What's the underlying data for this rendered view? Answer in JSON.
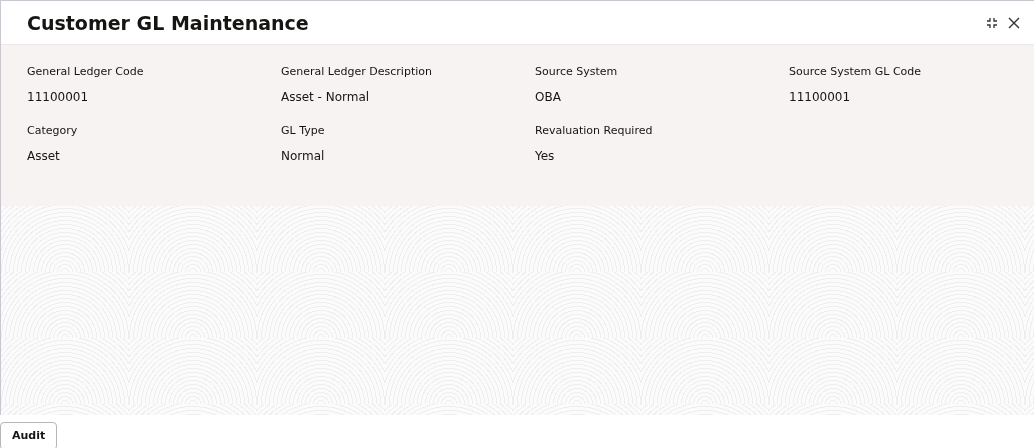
{
  "window": {
    "title": "Customer GL Maintenance"
  },
  "fields": [
    {
      "label": "General Ledger Code",
      "value": "11100001"
    },
    {
      "label": "General Ledger Description",
      "value": "Asset - Normal"
    },
    {
      "label": "Source System",
      "value": "OBA"
    },
    {
      "label": "Source System GL Code",
      "value": "11100001"
    },
    {
      "label": "Category",
      "value": "Asset"
    },
    {
      "label": "GL Type",
      "value": "Normal"
    },
    {
      "label": "Revaluation Required",
      "value": "Yes"
    }
  ],
  "footer": {
    "buttons": [
      "Audit"
    ]
  }
}
